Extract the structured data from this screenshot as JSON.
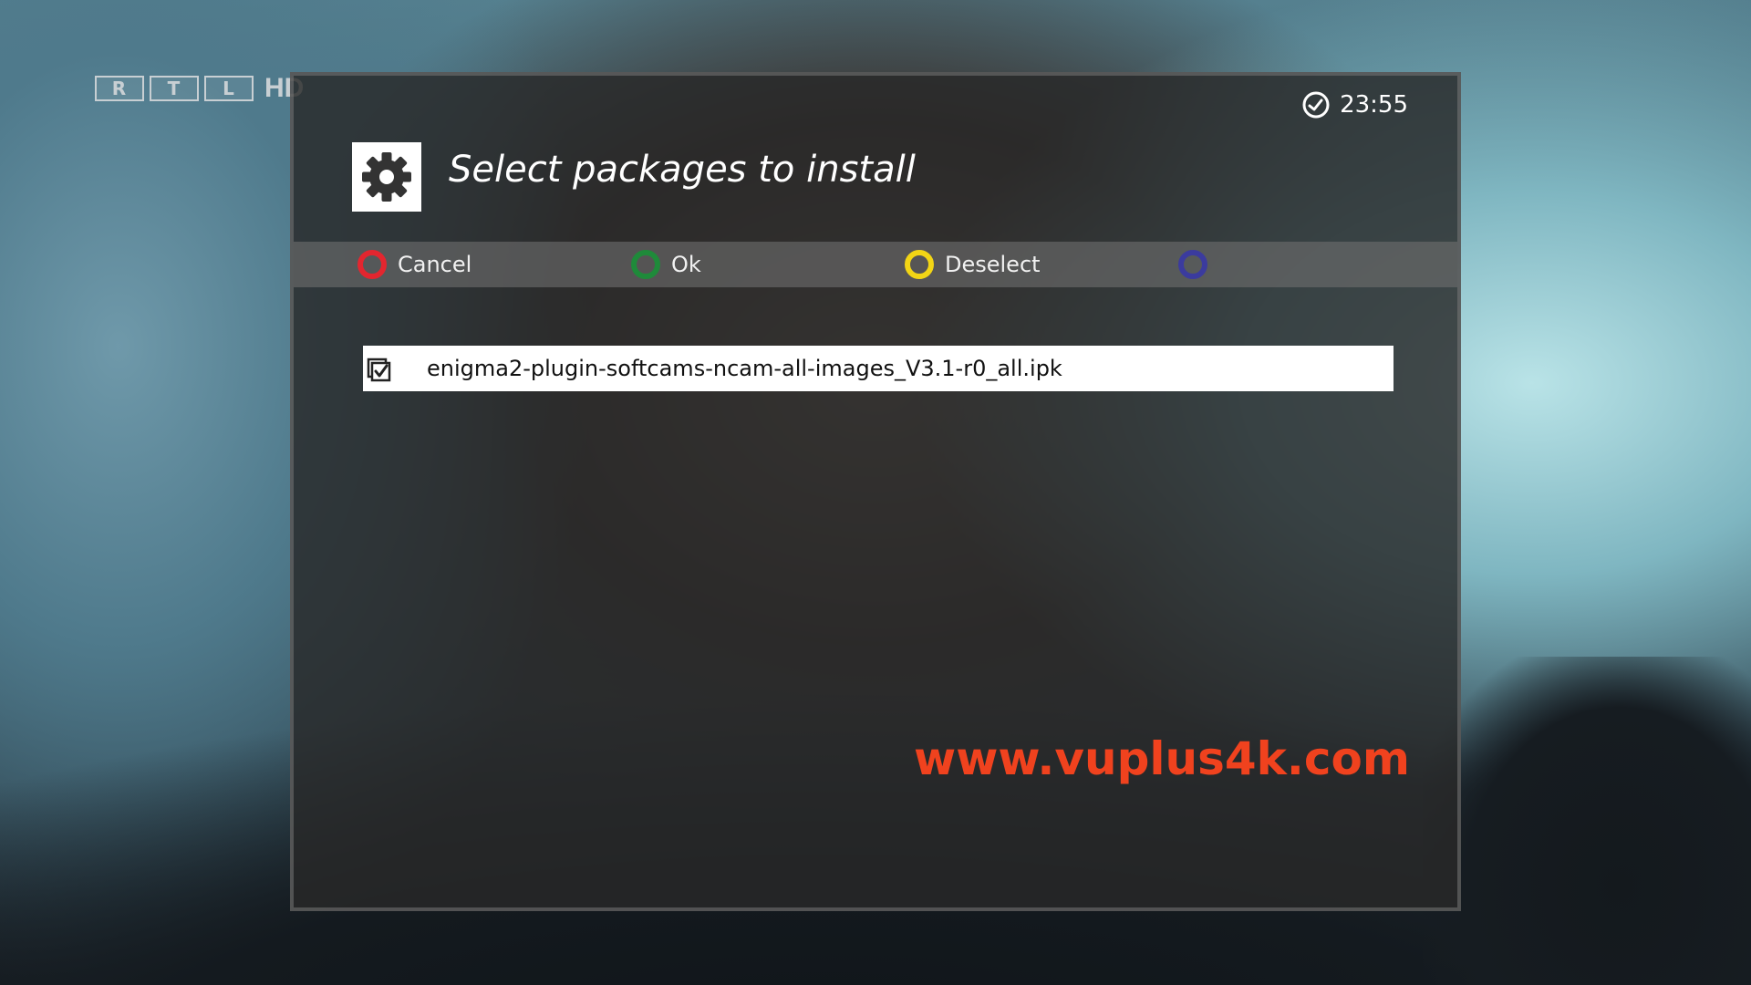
{
  "channel_logo": {
    "letters": [
      "R",
      "T",
      "L"
    ],
    "suffix": "HD"
  },
  "dialog": {
    "clock": {
      "icon": "clock-icon",
      "time": "23:55"
    },
    "title": {
      "icon": "gear-icon",
      "text": "Select packages to install"
    },
    "buttons": [
      {
        "key": "red",
        "label": "Cancel",
        "color": "#e3262f"
      },
      {
        "key": "green",
        "label": "Ok",
        "color": "#1f8a3a"
      },
      {
        "key": "yellow",
        "label": "Deselect",
        "color": "#f2d515"
      },
      {
        "key": "blue",
        "label": "",
        "color": "#3b3b9e"
      }
    ],
    "packages": [
      {
        "checked": true,
        "name": "enigma2-plugin-softcams-ncam-all-images_V3.1-r0_all.ipk"
      }
    ]
  },
  "watermark": "www.vuplus4k.com",
  "colors": {
    "dialog_bg": "#282828",
    "button_bar_bg": "#6e6e6e",
    "selected_row_bg": "#ffffff",
    "watermark": "#f0421e"
  }
}
